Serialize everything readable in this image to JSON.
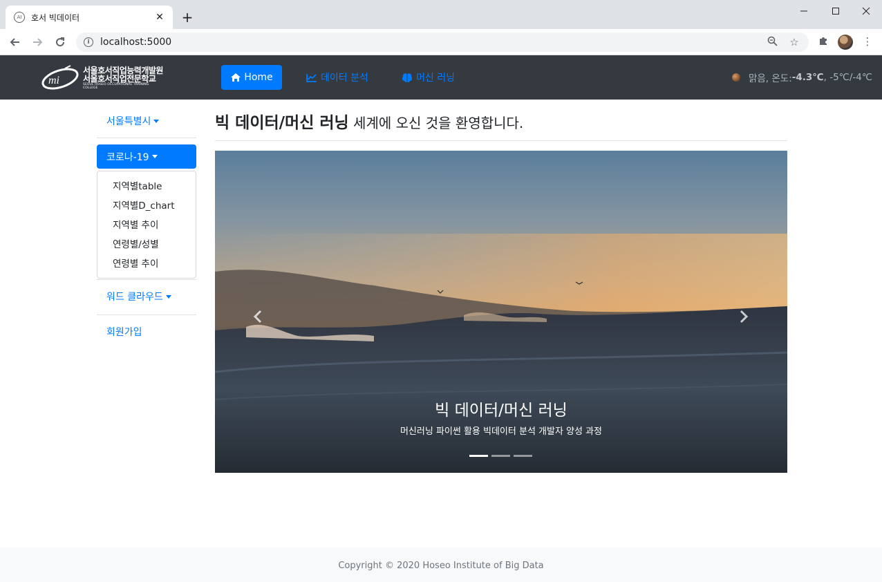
{
  "browser": {
    "tab_title": "호서 빅데이터",
    "favicon_text": "AI",
    "url": "localhost:5000"
  },
  "navbar": {
    "logo": {
      "line1": "서울호서직업능력개발원",
      "line2": "서울호서직업전문학교",
      "line3": "SEOUL HOSEO OCCUPATIONAL TRAINING COLLEGE"
    },
    "home_label": "Home",
    "data_analysis_label": "데이터 분석",
    "machine_learning_label": "머신 러닝",
    "weather": {
      "prefix": "맑음, 온도: ",
      "temp": "-4.3℃",
      "range": ", -5℃/-4℃"
    },
    "colors": {
      "bg": "#343a40",
      "accent": "#007bff"
    }
  },
  "sidebar": {
    "seoul": "서울특별시",
    "corona": "코로나-19",
    "corona_items": [
      "지역별table",
      "지역별D_chart",
      "지역별 추이",
      "연령별/성별",
      "연령별 추이"
    ],
    "wordcloud": "워드 클라우드",
    "signup": "회원가입"
  },
  "main": {
    "heading_strong": "빅 데이터/머신 러닝",
    "heading_rest": " 세계에 오신 것을 환영합니다.",
    "carousel": {
      "caption_title": "빅 데이터/머신 러닝",
      "caption_sub": "머신러닝 파이썬 활용 빅데이터 분석 개발자 양성 과정",
      "slide_count": 3,
      "active_index": 0
    }
  },
  "footer": {
    "copyright": "Copyright © 2020 Hoseo Institute of Big Data"
  }
}
